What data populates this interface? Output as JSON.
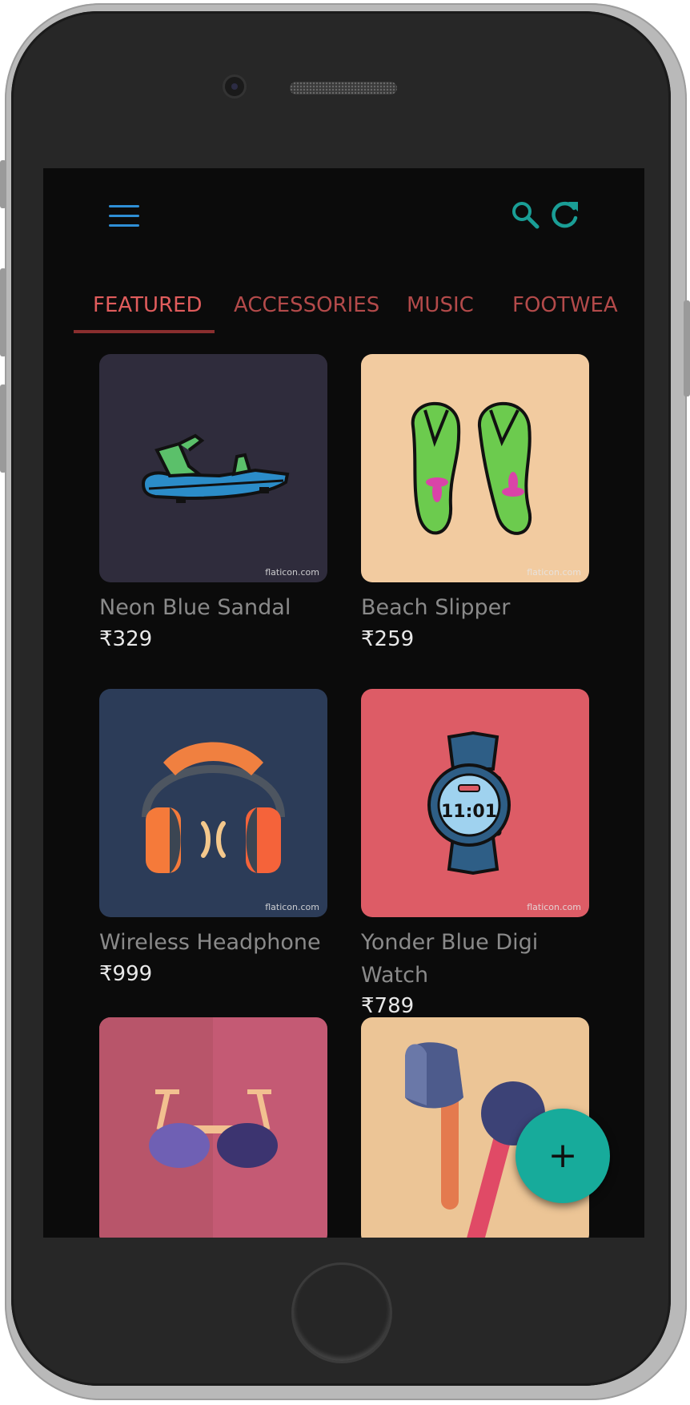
{
  "toolbar": {
    "menu_icon": "hamburger-menu-icon",
    "search_icon": "search-icon",
    "refresh_icon": "refresh-icon",
    "accent_color": "#1a9e96"
  },
  "tabs": [
    {
      "label": "FEATURED",
      "active": true
    },
    {
      "label": "ACCESSORIES",
      "active": false
    },
    {
      "label": "MUSIC",
      "active": false
    },
    {
      "label": "FOOTWEA",
      "active": false
    }
  ],
  "products": [
    {
      "name": "Neon Blue Sandal",
      "price": "₹329",
      "credit": "flaticon.com",
      "bg": "#2f2c3c"
    },
    {
      "name": "Beach Slipper",
      "price": "₹259",
      "credit": "flaticon.com",
      "bg": "#f2cba0"
    },
    {
      "name": "Wireless Headphone",
      "price": "₹999",
      "credit": "flaticon.com",
      "bg": "#2c3c58"
    },
    {
      "name": "Yonder Blue Digi Watch",
      "price": "₹789",
      "credit": "flaticon.com",
      "bg": "#dd5c66",
      "watch_time": "11:01"
    },
    {
      "name": "",
      "price": "",
      "bg": "#c45a74"
    },
    {
      "name": "",
      "price": "",
      "bg": "#ecc596"
    }
  ],
  "fab": {
    "label": "+",
    "color": "#17ab9b"
  }
}
